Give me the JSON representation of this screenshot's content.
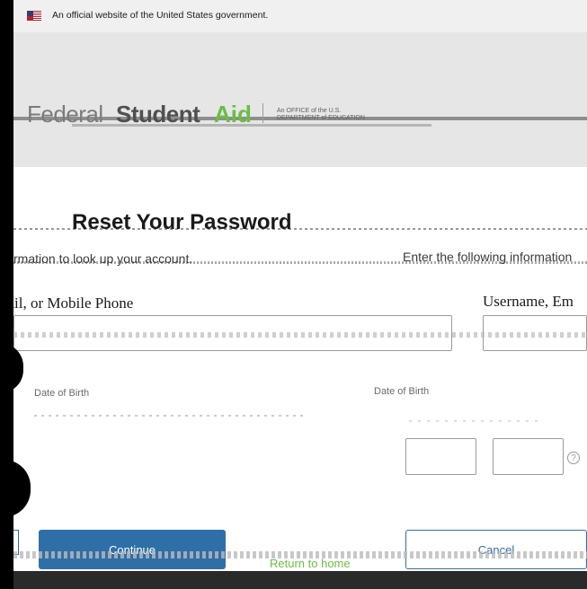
{
  "gov_banner": {
    "text": "An official website of the United States government."
  },
  "logo": {
    "part1": "Federal",
    "part2": "Student",
    "part3": "Aid",
    "dept": "An OFFICE of the U.S. DEPARTMENT of EDUCATION"
  },
  "page": {
    "title": "Reset Your Password",
    "instruction_left": "rmation to look up your account.",
    "instruction_right": "Enter the following information"
  },
  "form": {
    "left_label": "nail, or Mobile Phone",
    "right_label": "Username, Em",
    "dob_left": "Date of Birth",
    "dob_right": "Date of Birth",
    "help_glyph": "?"
  },
  "buttons": {
    "continue": "Continue",
    "cancel": "Cancel"
  },
  "footer": {
    "link": "Return to home"
  },
  "colors": {
    "brand_blue": "#2f6fa8",
    "aid_green": "#6cbd45"
  }
}
